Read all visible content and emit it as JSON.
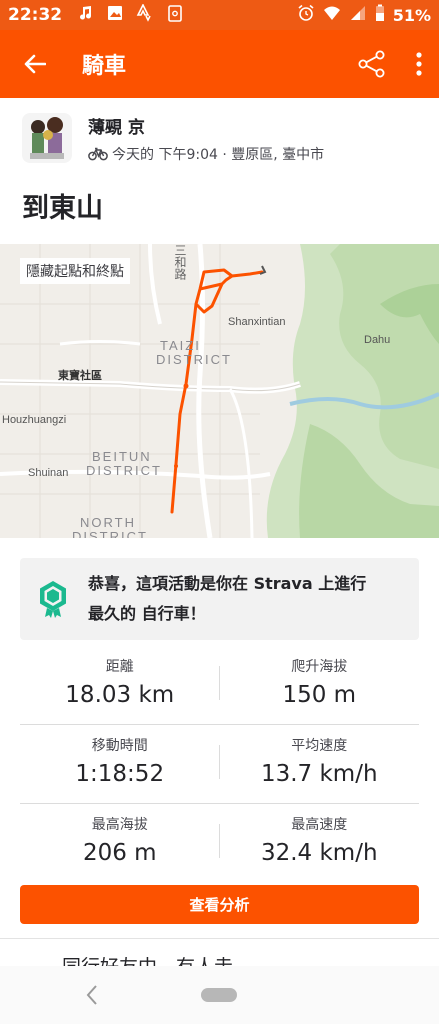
{
  "status_bar": {
    "time": "22:32",
    "battery": "51%",
    "icons": [
      "music-note-icon",
      "image-icon",
      "strava-icon",
      "clipboard-icon",
      "alarm-icon",
      "wifi-icon",
      "signal-icon",
      "battery-icon"
    ]
  },
  "app_bar": {
    "title": "騎車",
    "back_icon": "back-arrow-icon",
    "share_icon": "share-icon",
    "more_icon": "more-vert-icon"
  },
  "athlete": {
    "name": "薄覡 京",
    "activity_icon": "bike-icon",
    "meta": "今天的 下午9:04 · 豐原區, 臺中市"
  },
  "activity": {
    "title": "到東山"
  },
  "map": {
    "hide_endpoints_label": "隱藏起點和終點",
    "labels": {
      "sanhe_road": "三和路",
      "shanxintian": "Shanxintian",
      "dahu": "Dahu",
      "taizi": "TAIZI",
      "taizi_district": "DISTRICT",
      "dongbao": "東寶社區",
      "houzhuangzi": "Houzhuangzi",
      "beitun": "BEITUN",
      "beitun_district": "DISTRICT",
      "shuinan": "Shuinan",
      "north": "NORTH",
      "north_district": "DISTRICT"
    },
    "route_color": "#fc5200"
  },
  "achievement": {
    "icon": "achievement-badge-icon",
    "line1": "恭喜，這項活動是你在 Strava 上進行",
    "line2": "最久的 自行車！"
  },
  "stats": [
    [
      {
        "label": "距離",
        "value": "18.03 km"
      },
      {
        "label": "爬升海拔",
        "value": "150 m"
      }
    ],
    [
      {
        "label": "移動時間",
        "value": "1:18:52"
      },
      {
        "label": "平均速度",
        "value": "13.7 km/h"
      }
    ],
    [
      {
        "label": "最高海拔",
        "value": "206 m"
      },
      {
        "label": "最高速度",
        "value": "32.4 km/h"
      }
    ]
  ],
  "analyze_button": "查看分析",
  "cut_off_text": "同行好友中，有人走",
  "colors": {
    "brand": "#fc5200",
    "status_bar": "#ee5a14"
  }
}
